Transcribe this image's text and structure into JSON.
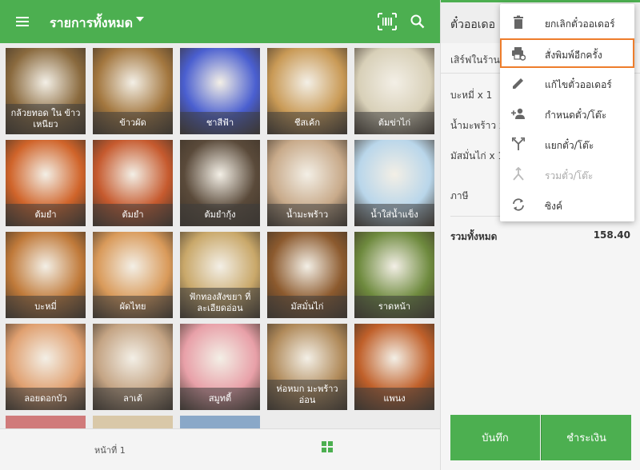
{
  "topbar": {
    "title": "รายการทั้งหมด"
  },
  "items": [
    {
      "name": "กล้วยทอด ใน ข้าวเหนียว",
      "color": "#8a6a3e"
    },
    {
      "name": "ข้าวผัด",
      "color": "#a3773f"
    },
    {
      "name": "ชาสีฟ้า",
      "color": "#4a5fd0"
    },
    {
      "name": "ชีสเค้ก",
      "color": "#c99a56"
    },
    {
      "name": "ต้มข่าไก่",
      "color": "#d8d0b8"
    },
    {
      "name": "ต้มยำ",
      "color": "#d0642a"
    },
    {
      "name": "ต้มยำ",
      "color": "#c65a2e"
    },
    {
      "name": "ต้มยำกุ้ง",
      "color": "#5a4a3a"
    },
    {
      "name": "น้ำมะพร้าว",
      "color": "#c8aa8a"
    },
    {
      "name": "น้ำใส่น้ำแข็ง",
      "color": "#b9d6ea"
    },
    {
      "name": "บะหมี่",
      "color": "#c07a3a"
    },
    {
      "name": "ผัดไทย",
      "color": "#d99a5a"
    },
    {
      "name": "ฟักทองสังขยา ที่ละเอียดอ่อน",
      "color": "#c9a86a"
    },
    {
      "name": "มัสมั่นไก่",
      "color": "#8c5a2e"
    },
    {
      "name": "ราดหน้า",
      "color": "#6e8a3e"
    },
    {
      "name": "ลอยดอกบัว",
      "color": "#e0a070"
    },
    {
      "name": "ลาเต้",
      "color": "#c4a484"
    },
    {
      "name": "สมูทตี้",
      "color": "#e8a0a8"
    },
    {
      "name": "ห่อหมก มะพร้าวอ่อน",
      "color": "#b08a5a"
    },
    {
      "name": "แพนง",
      "color": "#c0602a"
    }
  ],
  "bottombar": {
    "page_label": "หน้าที่ 1"
  },
  "panel": {
    "title": "ตั๋วออเดอ",
    "service": "เสิร์ฟในร้าน",
    "lines": [
      "บะหมี่ x 1",
      "น้ำมะพร้าว x",
      "มัสมั่นไก่ x 1"
    ],
    "tax_label": "ภาษี",
    "total_label": "รวมทั้งหมด",
    "total_value": "158.40",
    "save_label": "บันทึก",
    "pay_label": "ชำระเงิน"
  },
  "menu": [
    {
      "label": "ยกเลิกตั๋วออเดอร์",
      "icon": "trash-icon"
    },
    {
      "label": "สั่งพิมพ์อีกครั้ง",
      "icon": "reprint-icon"
    },
    {
      "label": "แก้ไขตั๋วออเดอร์",
      "icon": "edit-icon"
    },
    {
      "label": "กำหนดตั๋ว/โต๊ะ",
      "icon": "assign-user-icon"
    },
    {
      "label": "แยกตั๋ว/โต๊ะ",
      "icon": "split-icon"
    },
    {
      "label": "รวมตั๋ว/โต๊ะ",
      "icon": "merge-icon"
    },
    {
      "label": "ซิงค์",
      "icon": "sync-icon"
    }
  ],
  "colors": {
    "primary": "#4caf50",
    "highlight": "#ee7d2b"
  }
}
